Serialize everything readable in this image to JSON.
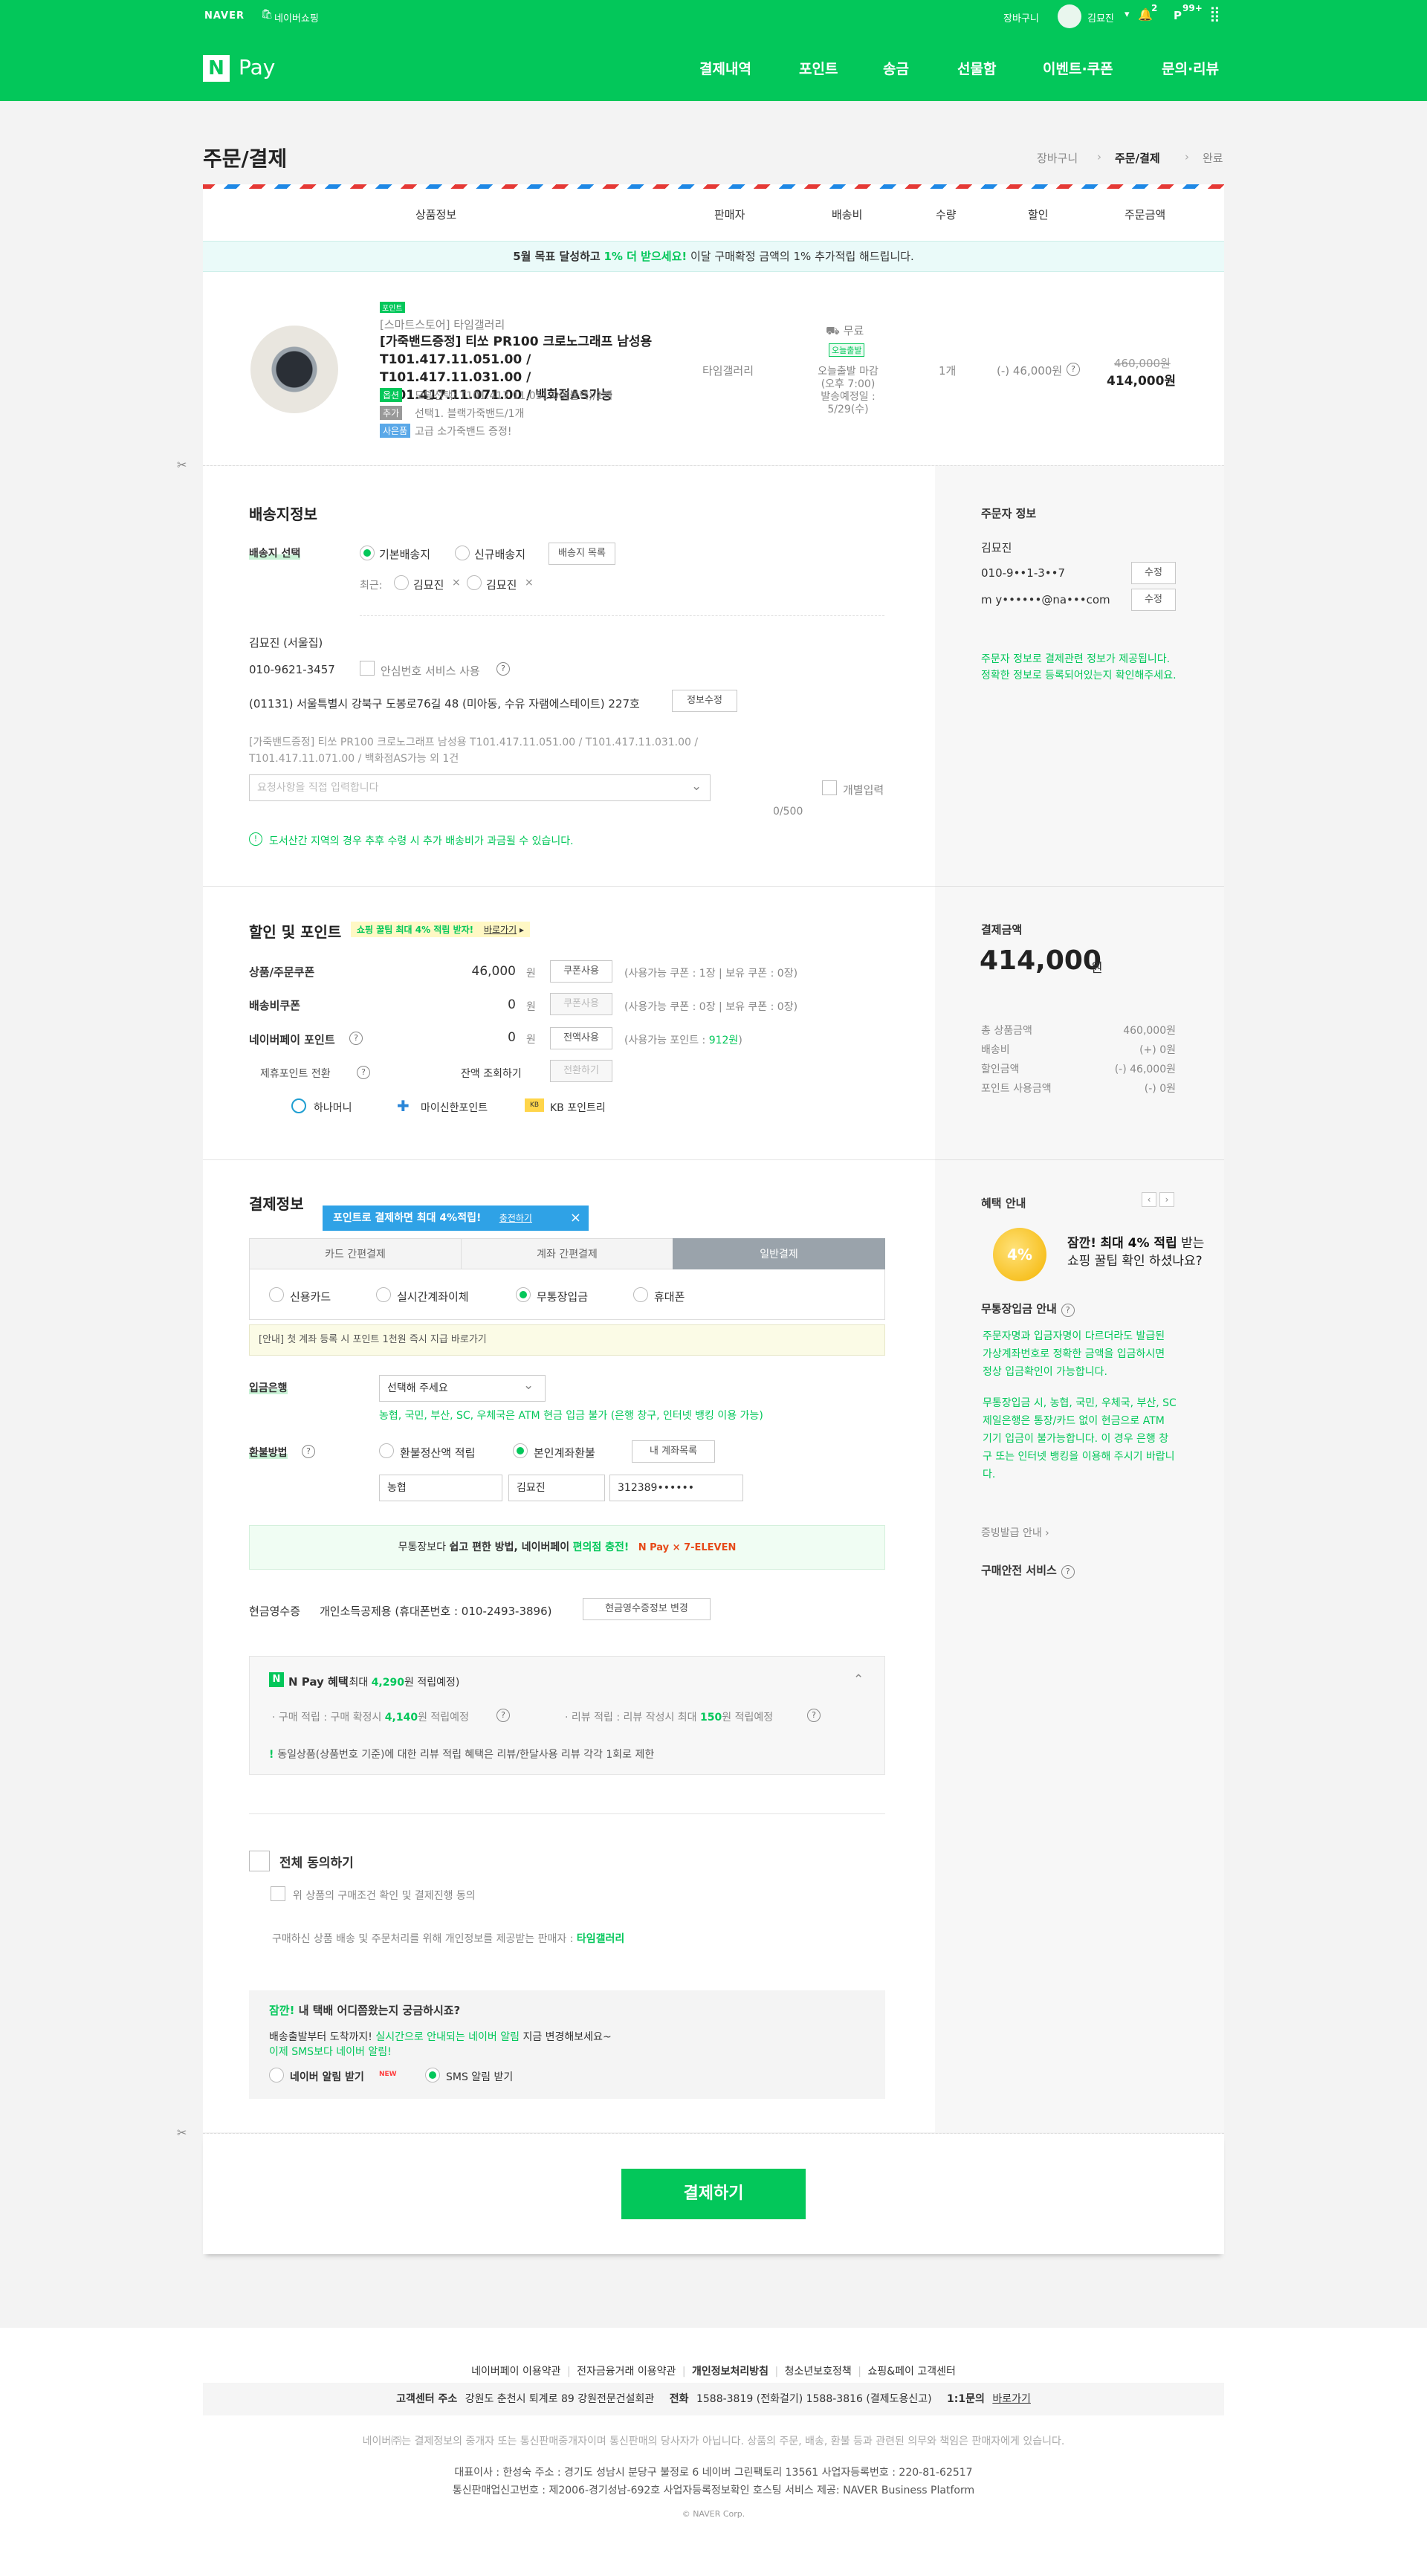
{
  "gnb": {
    "naver_logo": "NAVER",
    "shopping": "네이버쇼핑",
    "cart": "장바구니",
    "user": "김묘진",
    "noti_count": "2",
    "point_badge": "99+"
  },
  "lnb": {
    "pay_logo_n": "N",
    "pay_logo_text": "Pay",
    "menu": [
      "결제내역",
      "포인트",
      "송금",
      "선물함",
      "이벤트·쿠폰",
      "문의·리뷰"
    ]
  },
  "page": {
    "title": "주문/결제",
    "steps": [
      "장바구니",
      "주문/결제",
      "완료"
    ]
  },
  "table_header": [
    "상품정보",
    "판매자",
    "배송비",
    "수량",
    "할인",
    "주문금액"
  ],
  "promo_banner": {
    "pre": "5월 목표 달성하고",
    "highlight": "1% 더 받으세요!",
    "post": "이달 구매확정 금액의 1% 추가적립 해드립니다."
  },
  "product": {
    "badge": "포인트",
    "store": "[스마트스토어] 타임갤러리",
    "name": "[가죽밴드증정] 티쏘 PR100 크로노그래프 남성용 T101.417.11.051.00 / T101.417.11.031.00 / T101.417.11.071.00 / 백화점AS가능",
    "option_label": "옵션",
    "option_value": "모델선택: T101.417.11.051.00(블랙)/1개",
    "add_label": "추가",
    "add_value": "선택1. 블랙가죽밴드/1개",
    "gift_label": "사은품",
    "gift_value": "고급 소가죽밴드 증정!",
    "seller": "타임갤러리",
    "ship_free": "무료",
    "ship_today": "오늘출발",
    "ship_note1": "오늘출발 마감",
    "ship_note2": "(오후 7:00)",
    "ship_note3": "발송예정일 :",
    "ship_note4": "5/29(수)",
    "qty": "1개",
    "discount": "(-) 46,000원",
    "price_orig": "460,000원",
    "price_final": "414,000원"
  },
  "shipping": {
    "title": "배송지정보",
    "select_label": "배송지 선택",
    "opt_default": "기본배송지",
    "opt_new": "신규배송지",
    "list_btn": "배송지 목록",
    "recent_label": "최근:",
    "recent1": "김묘진",
    "recent2": "김묘진",
    "recipient": "김묘진 (서울집)",
    "phone": "010-9621-3457",
    "safe_num": "안심번호 서비스 사용",
    "address": "(01131) 서울특별시 강북구 도봉로76길 48 (미아동, 수유 자램에스테이트) 227호",
    "edit_btn": "정보수정",
    "product_line": "[가죽밴드증정] 티쏘 PR100 크로노그래프 남성용 T101.417.11.051.00 / T101.417.11.031.00 / T101.417.11.071.00 / 백화점AS가능 외 1건",
    "memo_placeholder": "요청사항을 직접 입력합니다",
    "memo_count": "0/500",
    "individual": "개별입력",
    "notice": "도서산간 지역의 경우 추후 수령 시 추가 배송비가 과금될 수 있습니다."
  },
  "orderer": {
    "title": "주문자 정보",
    "name": "김묘진",
    "phone": "010-9••1-3••7",
    "email": "m y••••••@na•••com",
    "edit": "수정",
    "notice1": "주문자 정보로 결제관련 정보가 제공됩니다.",
    "notice2": "정확한 정보로 등록되어있는지 확인해주세요."
  },
  "discount": {
    "title": "할인 및 포인트",
    "tip": "쇼핑 꿀팁 최대 4% 적립 받자!",
    "tip_link": "바로가기",
    "rows": [
      {
        "label": "상품/주문쿠폰",
        "value": "46,000",
        "unit": "원",
        "btn": "쿠폰사용",
        "note": "(사용가능 쿠폰 : 1장 | 보유 쿠폰 : 0장)"
      },
      {
        "label": "배송비쿠폰",
        "value": "0",
        "unit": "원",
        "btn": "쿠폰사용",
        "note": "(사용가능 쿠폰 : 0장 | 보유 쿠폰 : 0장)"
      },
      {
        "label": "네이버페이 포인트",
        "value": "0",
        "unit": "원",
        "btn": "전액사용",
        "note_pre": "(사용가능 포인트 : ",
        "note_val": "912원",
        "note_post": ")"
      }
    ],
    "partner_label": "제휴포인트 전환",
    "balance_label": "잔액 조회하기",
    "convert_btn": "전환하기",
    "partners": [
      "하나머니",
      "마이신한포인트",
      "KB 포인트리"
    ]
  },
  "payment_summary": {
    "title": "결제금액",
    "total": "414,000",
    "unit": "원",
    "rows": [
      {
        "label": "총 상품금액",
        "value": "460,000원"
      },
      {
        "label": "배송비",
        "value": "(+) 0원"
      },
      {
        "label": "할인금액",
        "value": "(-) 46,000원"
      },
      {
        "label": "포인트 사용금액",
        "value": "(-) 0원"
      }
    ]
  },
  "payinfo": {
    "title": "결제정보",
    "tooltip": "포인트로 결제하면 최대 4%적립!",
    "tooltip_link": "충전하기",
    "tabs": [
      "카드 간편결제",
      "계좌 간편결제",
      "일반결제"
    ],
    "methods": [
      "신용카드",
      "실시간계좌이체",
      "무통장입금",
      "휴대폰"
    ],
    "notice": "[안내] 첫 계좌 등록 시 포인트 1천원 즉시 지급 바로가기",
    "bank_label": "입금은행",
    "bank_placeholder": "선택해 주세요",
    "bank_note": "농협, 국민, 부산, SC, 우체국은 ATM 현금 입금 불가 (은행 창구, 인터넷 뱅킹 이용 가능)",
    "refund_label": "환불방법",
    "refund_opt1": "환불정산액 적립",
    "refund_opt2": "본인계좌환불",
    "my_account": "내 계좌목록",
    "bank_name": "농협",
    "holder": "김묘진",
    "account": "312389••••••",
    "charge_banner_pre": "무통장보다",
    "charge_banner_b": "쉽고 편한 방법, 네이버페이",
    "charge_banner_g": "편의점 충전!",
    "charge_brands": "N Pay × 7-ELEVEN",
    "receipt_label": "현금영수증",
    "receipt_value": "개인소득공제용 (휴대폰번호 : 010-2493-3896)",
    "receipt_btn": "현금영수증정보 변경",
    "benefit_title": "N Pay 혜택",
    "benefit_sub_pre": "(최대",
    "benefit_sub_val": "4,290",
    "benefit_sub_post": "원 적립예정)",
    "benefit1_pre": "· 구매 적립 : 구매 확정시",
    "benefit1_val": "4,140",
    "benefit1_post": "원 적립예정",
    "benefit2_pre": "· 리뷰 적립 : 리뷰 작성시 최대",
    "benefit2_val": "150",
    "benefit2_post": "원 적립예정",
    "benefit_note": "동일상품(상품번호 기준)에 대한 리뷰 적립 혜택은 리뷰/한달사용 리뷰 각각 1회로 제한"
  },
  "benefit_side": {
    "title": "혜택 안내",
    "coin": "4%",
    "headline1_pre": "잠깐!",
    "headline1_b": "최대 4% 적립",
    "headline1_post": "받는",
    "headline2": "쇼핑 꿀팁 확인 하셨나요?",
    "deposit_title": "무통장입금 안내",
    "deposit1": "주문자명과 입금자명이 다르더라도 발급된 가상계좌번호로 정확한 금액을 입금하시면 정상 입금확인이 가능합니다.",
    "deposit2": "무통장입금 시, 농협, 국민, 우체국, 부산, SC 제일은행은 통장/카드 없이 현금으로 ATM 기기 입금이 불가능합니다. 이 경우 은행 창구 또는 인터넷 뱅킹을 이용해 주시기 바랍니다.",
    "receipt_guide": "증빙발급 안내",
    "safe_service": "구매안전 서비스"
  },
  "agree": {
    "all": "전체 동의하기",
    "item1": "위 상품의 구매조건 확인 및 결제진행 동의",
    "note_pre": "구매하신 상품 배송 및 주문처리를 위해 개인정보를 제공받는 판매자 : ",
    "note_seller": "타임갤러리"
  },
  "delivery_alert": {
    "title_pre": "잠깐!",
    "title_post": "내 택배 어디쯤왔는지 궁금하시죠?",
    "line1_pre": "배송출발부터 도착까지!",
    "line1_g": "실시간으로 안내되는 네이버 알림",
    "line1_post": "지금 변경해보세요~",
    "line2": "이제 SMS보다 네이버 알림!",
    "opt1": "네이버 알림 받기",
    "opt1_new": "NEW",
    "opt2": "SMS 알림 받기"
  },
  "pay_button": "결제하기",
  "footer": {
    "links": [
      "네이버페이 이용약관",
      "전자금융거래 이용약관",
      "개인정보처리방침",
      "청소년보호정책",
      "쇼핑&페이 고객센터"
    ],
    "cs_label": "고객센터 주소",
    "cs_addr": "강원도 춘천시 퇴계로 89 강원전문건설회관",
    "tel_label": "전화",
    "tel": "1588-3819 (전화걸기) 1588-3816 (결제도용신고)",
    "qna": "1:1문의",
    "qna_link": "바로가기",
    "disclaimer": "네이버㈜는 결제정보의 중개자 또는 통신판매중개자이며 통신판매의 당사자가 아닙니다. 상품의 주문, 배송, 환불 등과 관련된 의무와 책임은 판매자에게 있습니다.",
    "corp1": "대표이사 : 한성숙   주소 : 경기도 성남시 분당구 불정로 6 네이버 그린팩토리 13561   사업자등록번호 : 220-81-62517",
    "corp2": "통신판매업신고번호 : 제2006-경기성남-692호   사업자등록정보확인   호스팅 서비스 제공: NAVER Business Platform",
    "copyright": "© NAVER Corp."
  }
}
